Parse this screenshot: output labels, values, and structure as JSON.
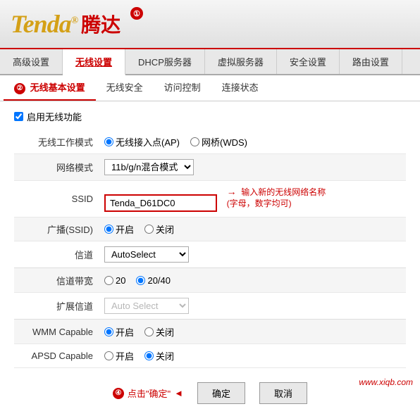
{
  "header": {
    "logo_text": "Tenda",
    "logo_reg": "®",
    "logo_chinese": "腾达",
    "circle1_label": "①"
  },
  "top_nav": {
    "items": [
      {
        "label": "高级设置",
        "active": false
      },
      {
        "label": "无线设置",
        "active": true
      },
      {
        "label": "DHCP服务器",
        "active": false
      },
      {
        "label": "虚拟服务器",
        "active": false
      },
      {
        "label": "安全设置",
        "active": false
      },
      {
        "label": "路由设置",
        "active": false
      }
    ]
  },
  "sub_nav": {
    "circle2_label": "②",
    "items": [
      {
        "label": "无线基本设置",
        "active": true
      },
      {
        "label": "无线安全",
        "active": false
      },
      {
        "label": "访问控制",
        "active": false
      },
      {
        "label": "连接状态",
        "active": false
      }
    ]
  },
  "form": {
    "enable_wireless_label": "启用无线功能",
    "enable_wireless_checked": true,
    "rows": [
      {
        "label": "无线工作模式",
        "type": "radio",
        "options": [
          "无线接入点(AP)",
          "网桥(WDS)"
        ],
        "selected": 0,
        "shaded": false
      },
      {
        "label": "网络模式",
        "type": "select",
        "options": [
          "11b/g/n混合模式"
        ],
        "selected": "11b/g/n混合模式",
        "shaded": true
      },
      {
        "label": "SSID",
        "type": "ssid",
        "value": "Tenda_D61DC0",
        "hint_arrow": "→",
        "hint_text": "输入新的无线网络名称\n(字母，数字均可)",
        "shaded": false
      },
      {
        "label": "广播(SSID)",
        "type": "radio",
        "options": [
          "开启",
          "关闭"
        ],
        "selected": 0,
        "shaded": true
      },
      {
        "label": "信道",
        "type": "select",
        "options": [
          "AutoSelect"
        ],
        "selected": "AutoSelect",
        "shaded": false
      }
    ],
    "rows2": [
      {
        "label": "信道带宽",
        "type": "radio",
        "options": [
          "20",
          "20/40"
        ],
        "selected": 1,
        "shaded": true
      },
      {
        "label": "扩展信道",
        "type": "select_disabled",
        "value": "Auto Select",
        "shaded": false
      }
    ],
    "rows3": [
      {
        "label": "WMM Capable",
        "type": "radio",
        "options": [
          "开启",
          "关闭"
        ],
        "selected": 0,
        "shaded": true
      },
      {
        "label": "APSD Capable",
        "type": "radio",
        "options": [
          "开启",
          "关闭"
        ],
        "selected": 1,
        "shaded": false
      }
    ]
  },
  "buttons": {
    "confirm_label": "确定",
    "cancel_label": "取消",
    "hint_circle": "④",
    "hint_text": "点击\"确定\""
  },
  "footer": {
    "url": "www.xiqb.com"
  }
}
